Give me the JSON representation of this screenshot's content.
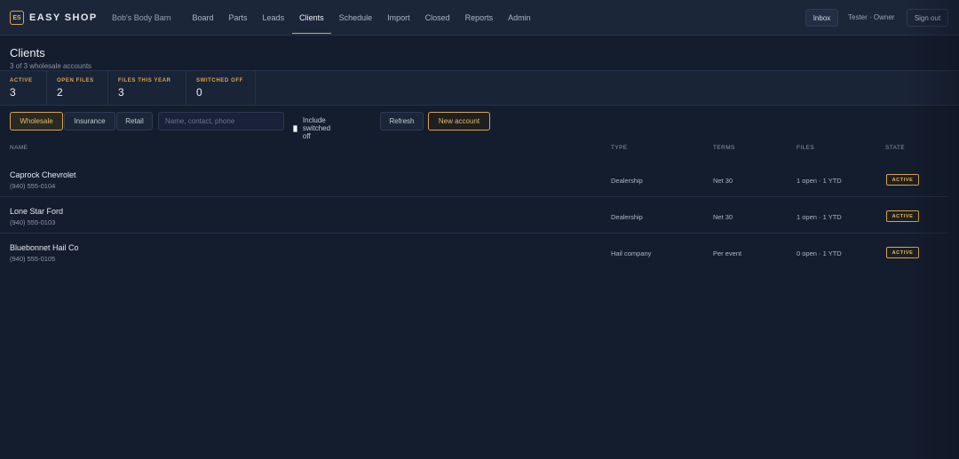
{
  "header": {
    "logo_text": "ES",
    "brand": "EASY SHOP",
    "shop_name": "Bob's Body Barn",
    "nav": [
      {
        "label": "Board"
      },
      {
        "label": "Parts"
      },
      {
        "label": "Leads"
      },
      {
        "label": "Clients",
        "active": true
      },
      {
        "label": "Schedule"
      },
      {
        "label": "Import"
      },
      {
        "label": "Closed"
      },
      {
        "label": "Reports"
      },
      {
        "label": "Admin"
      }
    ],
    "inbox_label": "Inbox",
    "user_label": "Tester · Owner",
    "signout_label": "Sign out"
  },
  "page": {
    "title": "Clients",
    "subtitle": "3 of 3 wholesale accounts"
  },
  "stats": [
    {
      "label": "ACTIVE",
      "value": "3"
    },
    {
      "label": "OPEN FILES",
      "value": "2"
    },
    {
      "label": "FILES THIS YEAR",
      "value": "3"
    },
    {
      "label": "SWITCHED OFF",
      "value": "0"
    }
  ],
  "filters": {
    "tabs": [
      {
        "label": "Wholesale",
        "selected": true
      },
      {
        "label": "Insurance"
      },
      {
        "label": "Retail"
      }
    ],
    "search_placeholder": "Name, contact, phone",
    "search_value": "",
    "include_switched_off_label": "Include switched off",
    "include_switched_off_checked": false,
    "refresh_label": "Refresh",
    "new_account_label": "New account"
  },
  "table": {
    "columns": [
      "NAME",
      "TYPE",
      "TERMS",
      "FILES",
      "STATE"
    ],
    "rows": [
      {
        "name": "Caprock Chevrolet",
        "phone": "(940) 555-0104",
        "type": "Dealership",
        "terms": "Net 30",
        "files": "1 open · 1 YTD",
        "state": "ACTIVE"
      },
      {
        "name": "Lone Star Ford",
        "phone": "(940) 555-0103",
        "type": "Dealership",
        "terms": "Net 30",
        "files": "1 open · 1 YTD",
        "state": "ACTIVE"
      },
      {
        "name": "Bluebonnet Hail Co",
        "phone": "(940) 555-0105",
        "type": "Hail company",
        "terms": "Per event",
        "files": "0 open · 1 YTD",
        "state": "ACTIVE"
      }
    ]
  },
  "colors": {
    "accent": "#d9a44a",
    "background": "#141d2e",
    "topbar": "#1b2639"
  }
}
